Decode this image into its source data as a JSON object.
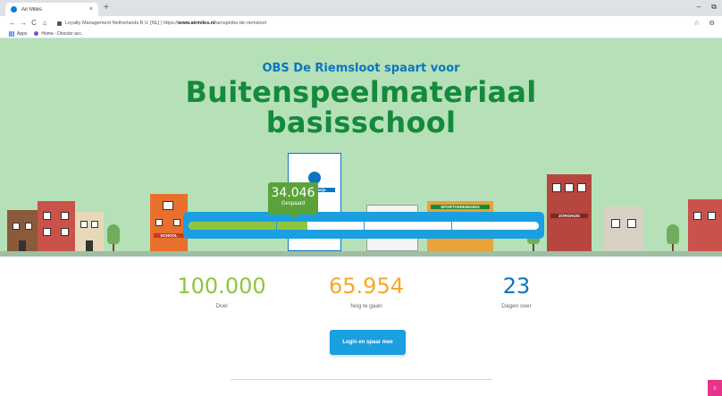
{
  "browser": {
    "tab_title": "Air Miles",
    "tab_close": "×",
    "new_tab": "+",
    "minimize": "–",
    "restore": "⧉",
    "back": "←",
    "forward": "→",
    "reload": "C",
    "home": "⌂",
    "url_owner": "Loyalty Management Netherlands B.V. [NL]",
    "url_separator": "|",
    "url_prefix": "https://",
    "url_host": "www.airmiles.nl",
    "url_path": "/amsp/obs-de-riemsloot",
    "star": "☆",
    "profile": "⊖",
    "bookmarks": [
      {
        "label": "Apps",
        "icon": "apps-icon"
      },
      {
        "label": "Home - Director acc..",
        "icon": "bookmark-favicon"
      }
    ]
  },
  "hero": {
    "subtitle": "OBS De Riemsloot spaart voor",
    "title_line1": "Buitenspeelmateriaal",
    "title_line2": "basisschool",
    "signs": {
      "school": "SCHOOL",
      "supermarket": "Albert Heijn",
      "sports": "SPORTVERENIGING",
      "care": "ZORGHUIS"
    }
  },
  "progress": {
    "saved_value": "34.046",
    "saved_label": "Gespaard",
    "fraction": 0.34046
  },
  "stats": [
    {
      "value": "100.000",
      "label": "Doel",
      "color": "#8dc63f"
    },
    {
      "value": "65.954",
      "label": "Nog te gaan",
      "color": "#f7a823"
    },
    {
      "value": "23",
      "label": "Dagen over",
      "color": "#0a75c2"
    }
  ],
  "cta": {
    "label": "Login en spaar mee"
  },
  "help": {
    "icon": "lightbulb-icon",
    "glyph": "♀"
  },
  "colors": {
    "brand_blue": "#1a9fe0",
    "brand_green": "#138a3c",
    "hero_bg": "#b6e0b8",
    "help_pink": "#e8338a"
  }
}
